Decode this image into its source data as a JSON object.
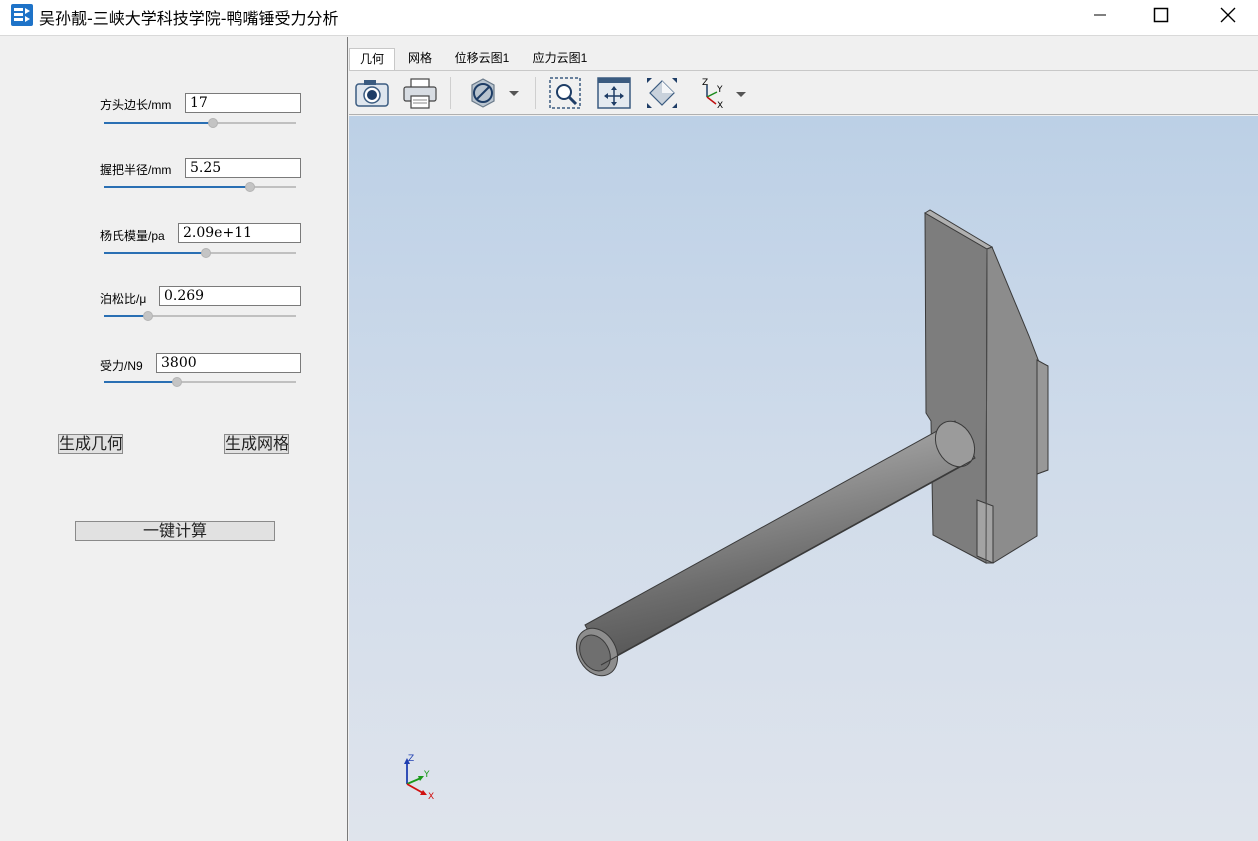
{
  "window": {
    "title": "吴孙靓-三峡大学科技学院-鸭嘴锤受力分析",
    "icon": "app-logo-icon",
    "controls": [
      "minimize-icon",
      "maximize-icon",
      "close-icon"
    ]
  },
  "params": [
    {
      "label": "方头边长/mm",
      "value": "17",
      "slider_fraction": 0.57
    },
    {
      "label": "握把半径/mm",
      "value": "5.25",
      "slider_fraction": 0.76
    },
    {
      "label": "杨氏模量/pa",
      "value": "2.09e+11",
      "slider_fraction": 0.53
    },
    {
      "label": "泊松比/μ",
      "value": "0.269",
      "slider_fraction": 0.23
    },
    {
      "label": "受力/N9",
      "value": "3800",
      "slider_fraction": 0.38
    }
  ],
  "buttons": {
    "generate_geometry": "生成几何",
    "generate_mesh": "生成网格",
    "compute": "一键计算"
  },
  "tabs": [
    {
      "label": "几何",
      "active": true
    },
    {
      "label": "网格",
      "active": false
    },
    {
      "label": "位移云图1",
      "active": false
    },
    {
      "label": "应力云图1",
      "active": false
    }
  ],
  "toolbar": [
    "camera-icon",
    "print-icon",
    "clip-plane-icon",
    "zoom-box-icon",
    "fit-all-icon",
    "isometric-view-icon",
    "axis-orientation-icon"
  ],
  "triad": {
    "x": "X",
    "y": "Y",
    "z": "Z"
  },
  "colors": {
    "accent": "#2a6fb3",
    "model": "#8a8a8a",
    "background_top": "#bcd0e6",
    "background_bottom": "#dfe4ec"
  }
}
